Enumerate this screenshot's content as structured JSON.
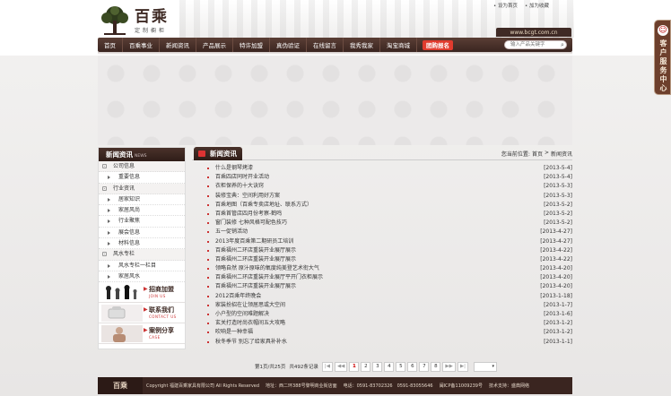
{
  "top_links": [
    "设为首页",
    "加为收藏"
  ],
  "logo": {
    "name": "百乘",
    "tagline": "定制橱柜"
  },
  "domain": "www.bcgt.com.cn",
  "nav": {
    "items": [
      "首页",
      "百乘事业",
      "新闻资讯",
      "产品展示",
      "特许加盟",
      "真伪验证",
      "在线留言",
      "我秀我家",
      "淘宝商城"
    ],
    "hot_item": "团购报名",
    "search_placeholder": "输入产品关键字"
  },
  "side_tab": {
    "text": "客户服务中心"
  },
  "sidebar": {
    "title": "新闻资讯",
    "title_en": "NEWS",
    "items": [
      {
        "label": "公司信息",
        "level": 0
      },
      {
        "label": "重要信息",
        "level": 1
      },
      {
        "label": "行业资讯",
        "level": 0
      },
      {
        "label": "居家知识",
        "level": 1
      },
      {
        "label": "家居风尚",
        "level": 1
      },
      {
        "label": "行业聚焦",
        "level": 1
      },
      {
        "label": "展会信息",
        "level": 1
      },
      {
        "label": "材料信息",
        "level": 1
      },
      {
        "label": "风水专栏",
        "level": 0
      },
      {
        "label": "风水专栏一栏目",
        "level": 1
      },
      {
        "label": "家居风水",
        "level": 1
      }
    ],
    "promos": [
      {
        "title": "招商加盟",
        "sub": "JOIN US"
      },
      {
        "title": "联系我们",
        "sub": "CONTACT US"
      },
      {
        "title": "案例分享",
        "sub": "CASE"
      }
    ]
  },
  "main": {
    "tab": "新闻资讯",
    "breadcrumb": [
      "您当前位置:",
      "首页",
      ">",
      "新闻资讯"
    ],
    "news": [
      {
        "title": "什么是钢琴烤漆",
        "date": "[2013-5-4]"
      },
      {
        "title": "百乘四店同时开业活动",
        "date": "[2013-5-4]"
      },
      {
        "title": "衣柜保养的十大诀窍",
        "date": "[2013-5-3]"
      },
      {
        "title": "装修宝典：空间利用好方案",
        "date": "[2013-5-3]"
      },
      {
        "title": "百乘地图（百乘专卖店地址、联系方式）",
        "date": "[2013-5-2]"
      },
      {
        "title": "百乘首管店四月份考察-鹤鸣",
        "date": "[2013-5-2]"
      },
      {
        "title": "窗门装修 七种风格可配色技巧",
        "date": "[2013-5-2]"
      },
      {
        "title": "五一促销活动",
        "date": "[2013-4-27]"
      },
      {
        "title": "2013年度百乘第二期研员工培训",
        "date": "[2013-4-27]"
      },
      {
        "title": "百乘福州二环店重装开业展厅展示",
        "date": "[2013-4-22]"
      },
      {
        "title": "百乘福州二环店重装开业展厅展示",
        "date": "[2013-4-22]"
      },
      {
        "title": "领略自然 原汁原味的氧度纯美登艺术衔大气",
        "date": "[2013-4-20]"
      },
      {
        "title": "百乘福州二环店重装开业展厅平开门衣柜展示",
        "date": "[2013-4-20]"
      },
      {
        "title": "百乘福州二环店重装开业展厅展示",
        "date": "[2013-4-20]"
      },
      {
        "title": "2012百乘年终晚会",
        "date": "[2013-1-18]"
      },
      {
        "title": "家装扮招在让领居思或大空间",
        "date": "[2013-1-7]"
      },
      {
        "title": "小户型的空间难题解决",
        "date": "[2013-1-6]"
      },
      {
        "title": "玄关打造时尚衣帽间五大攻略",
        "date": "[2013-1-2]"
      },
      {
        "title": "吹响是一种幸福",
        "date": "[2013-1-2]"
      },
      {
        "title": "秋冬季节 别忘了给家具补补水",
        "date": "[2013-1-1]"
      }
    ],
    "pager": {
      "summary": "第1页/共25页",
      "total": "共492条记录",
      "buttons": [
        "|◀",
        "◀◀",
        "1",
        "2",
        "3",
        "4",
        "5",
        "6",
        "7",
        "8",
        "▶▶",
        "▶|"
      ],
      "current": "1"
    }
  },
  "footer": {
    "logo": "百乘",
    "copyright": "Copyright 福建百乘家具有限公司 All Rights Reserved",
    "address": "地址：西二环388号黎明商业街店面",
    "phone": "电话：0591-83702326　0591-83055646",
    "icp": "闽ICP备11009239号",
    "support": "技术支持：盛典网络"
  }
}
